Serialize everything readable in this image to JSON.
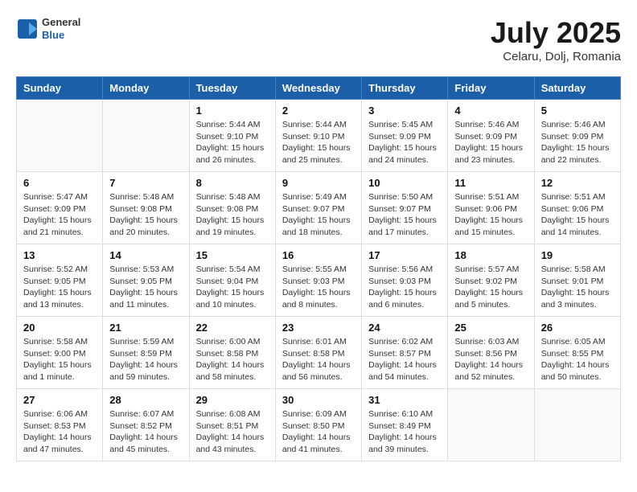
{
  "header": {
    "logo": {
      "line1": "General",
      "line2": "Blue"
    },
    "title": "July 2025",
    "location": "Celaru, Dolj, Romania"
  },
  "weekdays": [
    "Sunday",
    "Monday",
    "Tuesday",
    "Wednesday",
    "Thursday",
    "Friday",
    "Saturday"
  ],
  "weeks": [
    [
      {
        "day": "",
        "info": ""
      },
      {
        "day": "",
        "info": ""
      },
      {
        "day": "1",
        "info": "Sunrise: 5:44 AM\nSunset: 9:10 PM\nDaylight: 15 hours\nand 26 minutes."
      },
      {
        "day": "2",
        "info": "Sunrise: 5:44 AM\nSunset: 9:10 PM\nDaylight: 15 hours\nand 25 minutes."
      },
      {
        "day": "3",
        "info": "Sunrise: 5:45 AM\nSunset: 9:09 PM\nDaylight: 15 hours\nand 24 minutes."
      },
      {
        "day": "4",
        "info": "Sunrise: 5:46 AM\nSunset: 9:09 PM\nDaylight: 15 hours\nand 23 minutes."
      },
      {
        "day": "5",
        "info": "Sunrise: 5:46 AM\nSunset: 9:09 PM\nDaylight: 15 hours\nand 22 minutes."
      }
    ],
    [
      {
        "day": "6",
        "info": "Sunrise: 5:47 AM\nSunset: 9:09 PM\nDaylight: 15 hours\nand 21 minutes."
      },
      {
        "day": "7",
        "info": "Sunrise: 5:48 AM\nSunset: 9:08 PM\nDaylight: 15 hours\nand 20 minutes."
      },
      {
        "day": "8",
        "info": "Sunrise: 5:48 AM\nSunset: 9:08 PM\nDaylight: 15 hours\nand 19 minutes."
      },
      {
        "day": "9",
        "info": "Sunrise: 5:49 AM\nSunset: 9:07 PM\nDaylight: 15 hours\nand 18 minutes."
      },
      {
        "day": "10",
        "info": "Sunrise: 5:50 AM\nSunset: 9:07 PM\nDaylight: 15 hours\nand 17 minutes."
      },
      {
        "day": "11",
        "info": "Sunrise: 5:51 AM\nSunset: 9:06 PM\nDaylight: 15 hours\nand 15 minutes."
      },
      {
        "day": "12",
        "info": "Sunrise: 5:51 AM\nSunset: 9:06 PM\nDaylight: 15 hours\nand 14 minutes."
      }
    ],
    [
      {
        "day": "13",
        "info": "Sunrise: 5:52 AM\nSunset: 9:05 PM\nDaylight: 15 hours\nand 13 minutes."
      },
      {
        "day": "14",
        "info": "Sunrise: 5:53 AM\nSunset: 9:05 PM\nDaylight: 15 hours\nand 11 minutes."
      },
      {
        "day": "15",
        "info": "Sunrise: 5:54 AM\nSunset: 9:04 PM\nDaylight: 15 hours\nand 10 minutes."
      },
      {
        "day": "16",
        "info": "Sunrise: 5:55 AM\nSunset: 9:03 PM\nDaylight: 15 hours\nand 8 minutes."
      },
      {
        "day": "17",
        "info": "Sunrise: 5:56 AM\nSunset: 9:03 PM\nDaylight: 15 hours\nand 6 minutes."
      },
      {
        "day": "18",
        "info": "Sunrise: 5:57 AM\nSunset: 9:02 PM\nDaylight: 15 hours\nand 5 minutes."
      },
      {
        "day": "19",
        "info": "Sunrise: 5:58 AM\nSunset: 9:01 PM\nDaylight: 15 hours\nand 3 minutes."
      }
    ],
    [
      {
        "day": "20",
        "info": "Sunrise: 5:58 AM\nSunset: 9:00 PM\nDaylight: 15 hours\nand 1 minute."
      },
      {
        "day": "21",
        "info": "Sunrise: 5:59 AM\nSunset: 8:59 PM\nDaylight: 14 hours\nand 59 minutes."
      },
      {
        "day": "22",
        "info": "Sunrise: 6:00 AM\nSunset: 8:58 PM\nDaylight: 14 hours\nand 58 minutes."
      },
      {
        "day": "23",
        "info": "Sunrise: 6:01 AM\nSunset: 8:58 PM\nDaylight: 14 hours\nand 56 minutes."
      },
      {
        "day": "24",
        "info": "Sunrise: 6:02 AM\nSunset: 8:57 PM\nDaylight: 14 hours\nand 54 minutes."
      },
      {
        "day": "25",
        "info": "Sunrise: 6:03 AM\nSunset: 8:56 PM\nDaylight: 14 hours\nand 52 minutes."
      },
      {
        "day": "26",
        "info": "Sunrise: 6:05 AM\nSunset: 8:55 PM\nDaylight: 14 hours\nand 50 minutes."
      }
    ],
    [
      {
        "day": "27",
        "info": "Sunrise: 6:06 AM\nSunset: 8:53 PM\nDaylight: 14 hours\nand 47 minutes."
      },
      {
        "day": "28",
        "info": "Sunrise: 6:07 AM\nSunset: 8:52 PM\nDaylight: 14 hours\nand 45 minutes."
      },
      {
        "day": "29",
        "info": "Sunrise: 6:08 AM\nSunset: 8:51 PM\nDaylight: 14 hours\nand 43 minutes."
      },
      {
        "day": "30",
        "info": "Sunrise: 6:09 AM\nSunset: 8:50 PM\nDaylight: 14 hours\nand 41 minutes."
      },
      {
        "day": "31",
        "info": "Sunrise: 6:10 AM\nSunset: 8:49 PM\nDaylight: 14 hours\nand 39 minutes."
      },
      {
        "day": "",
        "info": ""
      },
      {
        "day": "",
        "info": ""
      }
    ]
  ]
}
